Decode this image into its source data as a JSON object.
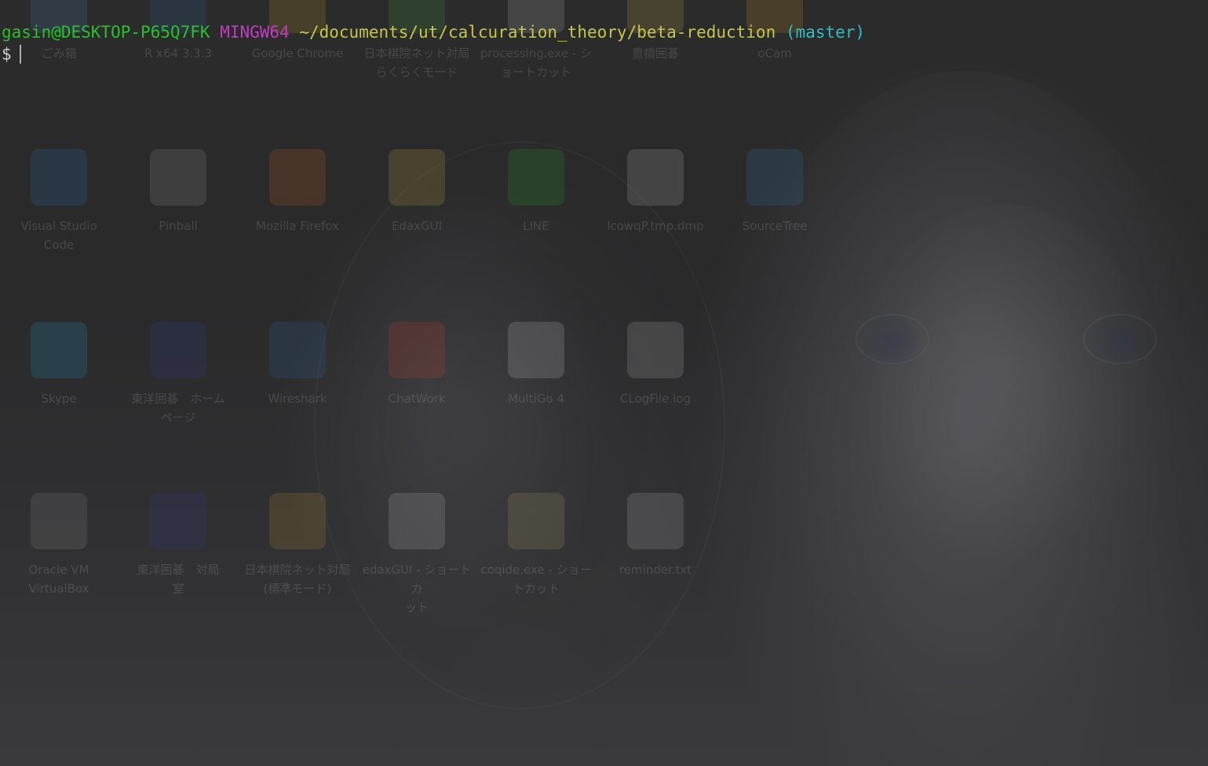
{
  "terminal": {
    "user_host": "gasin@DESKTOP-P65Q7FK",
    "shell": "MINGW64",
    "path": "~/documents/ut/calcuration_theory/beta-reduction",
    "branch": "(master)",
    "prompt": "$",
    "colors": {
      "user_host": "#27c227",
      "shell": "#c43ac4",
      "path": "#c7c742",
      "branch": "#2ac0c4",
      "prompt": "#d0d0d0",
      "background": "#262626"
    }
  },
  "desktop_icons": [
    {
      "caption": "ごみ箱",
      "icon": "recycle-bin-icon",
      "color": "#4a8fd1"
    },
    {
      "caption": "R x64 3.3.3",
      "icon": "r-icon",
      "color": "#2f63b5"
    },
    {
      "caption": "Google Chrome",
      "icon": "chrome-icon",
      "color": "#d9a52a"
    },
    {
      "caption": "日本棋院ネット対局\nらくらくモード",
      "icon": "igo-icon",
      "color": "#4fae43"
    },
    {
      "caption": "processing.exe - シ\nョートカット",
      "icon": "processing-icon",
      "color": "#cccccc"
    },
    {
      "caption": "豊橋囲碁",
      "icon": "go-icon",
      "color": "#e0c050"
    },
    {
      "caption": "oCam",
      "icon": "ocam-icon",
      "color": "#e0a020"
    },
    {
      "caption": "Visual Studio\nCode",
      "icon": "vscode-icon",
      "color": "#2a7ad6"
    },
    {
      "caption": "Pinball",
      "icon": "pinball-icon",
      "color": "#aaaaaa"
    },
    {
      "caption": "Mozilla Firefox",
      "icon": "firefox-icon",
      "color": "#e06a20"
    },
    {
      "caption": "EdaxGUI",
      "icon": "edaxgui-folder-icon",
      "color": "#e0c040"
    },
    {
      "caption": "LINE",
      "icon": "line-icon",
      "color": "#27b627"
    },
    {
      "caption": "lcowqP.tmp.dmp",
      "icon": "file-icon",
      "color": "#cccccc"
    },
    {
      "caption": "SourceTree",
      "icon": "sourcetree-icon",
      "color": "#3080c0"
    },
    {
      "caption": "Skype",
      "icon": "skype-icon",
      "color": "#1fa7e0"
    },
    {
      "caption": "東洋囲碁　ホーム\nページ",
      "icon": "toyo-igo-icon",
      "color": "#3040a0"
    },
    {
      "caption": "Wireshark",
      "icon": "wireshark-icon",
      "color": "#2a6fb0"
    },
    {
      "caption": "ChatWork",
      "icon": "chatwork-icon",
      "color": "#e0402a"
    },
    {
      "caption": "MultiGo 4",
      "icon": "multigo-icon",
      "color": "#dddddd"
    },
    {
      "caption": "CLogFile.log",
      "icon": "log-file-icon",
      "color": "#cccccc"
    },
    {
      "caption": "Oracle VM\nVirtualBox",
      "icon": "virtualbox-icon",
      "color": "#999999"
    },
    {
      "caption": "東洋囲碁　対局\n室",
      "icon": "toyo-igo-room-icon",
      "color": "#3040a0"
    },
    {
      "caption": "日本棋院ネット対局\n(標準モード)",
      "icon": "igo-standard-icon",
      "color": "#d0a030"
    },
    {
      "caption": "edaxGUI - ショートカ\nット",
      "icon": "edax-gui-icon",
      "color": "#cccccc"
    },
    {
      "caption": "coqide.exe - ショー\nトカット",
      "icon": "coqide-icon",
      "color": "#c0b060"
    },
    {
      "caption": "reminder.txt",
      "icon": "text-file-icon",
      "color": "#cccccc"
    }
  ]
}
